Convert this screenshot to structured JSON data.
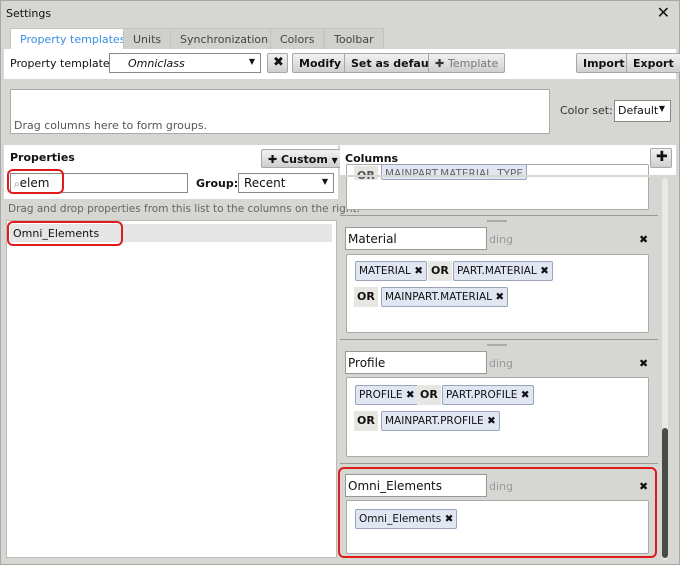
{
  "window": {
    "title": "Settings"
  },
  "tabs": [
    {
      "label": "Property templates",
      "active": true
    },
    {
      "label": "Units"
    },
    {
      "label": "Synchronization"
    },
    {
      "label": "Colors"
    },
    {
      "label": "Toolbar"
    }
  ],
  "toolbar": {
    "template_label": "Property template:",
    "template_value": "Omniclass",
    "modify": "Modify",
    "set_default": "Set as default",
    "add_template": "Template",
    "import": "Import",
    "export": "Export"
  },
  "grouping": {
    "placeholder": "Drag columns here to form groups.",
    "color_set_label": "Color set:",
    "color_set_value": "Default"
  },
  "properties": {
    "title": "Properties",
    "custom_button": "Custom",
    "search_value": "elem",
    "group_label": "Group:",
    "group_value": "Recent",
    "hint": "Drag and drop properties from this list to the columns on the right.",
    "items": [
      "Omni_Elements"
    ]
  },
  "columns": {
    "title": "Columns",
    "clipped_chip": "MAINPART.MATERIAL_TYPE",
    "or": "OR",
    "ding": "ding",
    "items": [
      {
        "name": "Material",
        "chips": [
          "MATERIAL",
          "PART.MATERIAL",
          "MAINPART.MATERIAL"
        ]
      },
      {
        "name": "Profile",
        "chips": [
          "PROFILE",
          "PART.PROFILE",
          "MAINPART.PROFILE"
        ]
      },
      {
        "name": "Omni_Elements",
        "chips": [
          "Omni_Elements"
        ]
      }
    ]
  },
  "colors": {
    "accent": "#3a8ee6",
    "highlight": "#e01b1b",
    "chip": "#e0e6f2"
  }
}
